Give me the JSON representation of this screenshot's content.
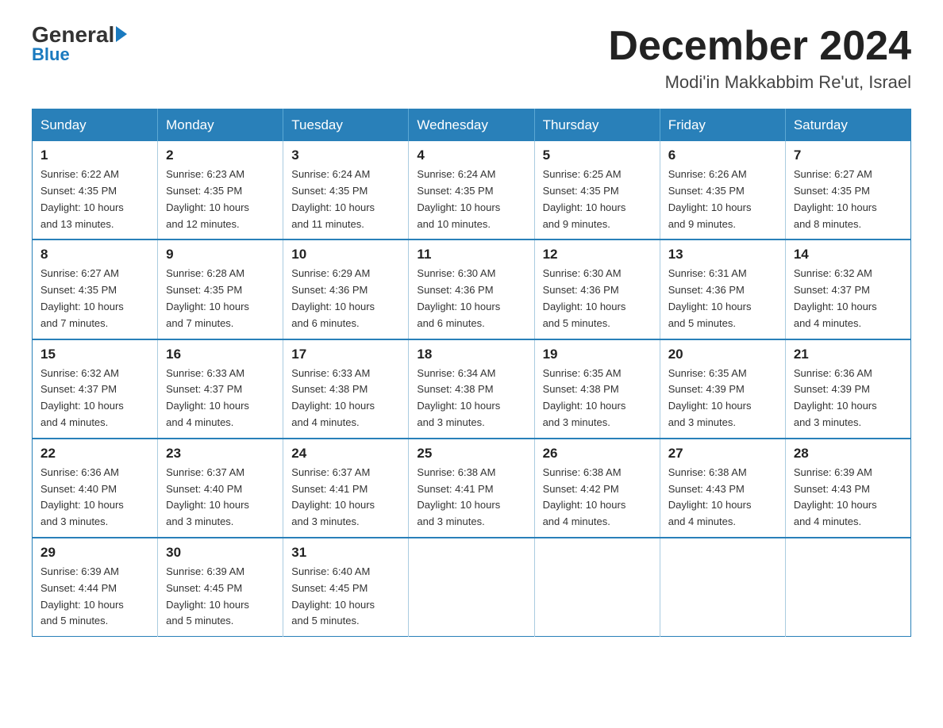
{
  "logo": {
    "general": "General",
    "blue": "Blue"
  },
  "header": {
    "month_year": "December 2024",
    "location": "Modi'in Makkabbim Re'ut, Israel"
  },
  "days_of_week": [
    "Sunday",
    "Monday",
    "Tuesday",
    "Wednesday",
    "Thursday",
    "Friday",
    "Saturday"
  ],
  "weeks": [
    [
      {
        "day": "1",
        "sunrise": "6:22 AM",
        "sunset": "4:35 PM",
        "daylight": "10 hours and 13 minutes."
      },
      {
        "day": "2",
        "sunrise": "6:23 AM",
        "sunset": "4:35 PM",
        "daylight": "10 hours and 12 minutes."
      },
      {
        "day": "3",
        "sunrise": "6:24 AM",
        "sunset": "4:35 PM",
        "daylight": "10 hours and 11 minutes."
      },
      {
        "day": "4",
        "sunrise": "6:24 AM",
        "sunset": "4:35 PM",
        "daylight": "10 hours and 10 minutes."
      },
      {
        "day": "5",
        "sunrise": "6:25 AM",
        "sunset": "4:35 PM",
        "daylight": "10 hours and 9 minutes."
      },
      {
        "day": "6",
        "sunrise": "6:26 AM",
        "sunset": "4:35 PM",
        "daylight": "10 hours and 9 minutes."
      },
      {
        "day": "7",
        "sunrise": "6:27 AM",
        "sunset": "4:35 PM",
        "daylight": "10 hours and 8 minutes."
      }
    ],
    [
      {
        "day": "8",
        "sunrise": "6:27 AM",
        "sunset": "4:35 PM",
        "daylight": "10 hours and 7 minutes."
      },
      {
        "day": "9",
        "sunrise": "6:28 AM",
        "sunset": "4:35 PM",
        "daylight": "10 hours and 7 minutes."
      },
      {
        "day": "10",
        "sunrise": "6:29 AM",
        "sunset": "4:36 PM",
        "daylight": "10 hours and 6 minutes."
      },
      {
        "day": "11",
        "sunrise": "6:30 AM",
        "sunset": "4:36 PM",
        "daylight": "10 hours and 6 minutes."
      },
      {
        "day": "12",
        "sunrise": "6:30 AM",
        "sunset": "4:36 PM",
        "daylight": "10 hours and 5 minutes."
      },
      {
        "day": "13",
        "sunrise": "6:31 AM",
        "sunset": "4:36 PM",
        "daylight": "10 hours and 5 minutes."
      },
      {
        "day": "14",
        "sunrise": "6:32 AM",
        "sunset": "4:37 PM",
        "daylight": "10 hours and 4 minutes."
      }
    ],
    [
      {
        "day": "15",
        "sunrise": "6:32 AM",
        "sunset": "4:37 PM",
        "daylight": "10 hours and 4 minutes."
      },
      {
        "day": "16",
        "sunrise": "6:33 AM",
        "sunset": "4:37 PM",
        "daylight": "10 hours and 4 minutes."
      },
      {
        "day": "17",
        "sunrise": "6:33 AM",
        "sunset": "4:38 PM",
        "daylight": "10 hours and 4 minutes."
      },
      {
        "day": "18",
        "sunrise": "6:34 AM",
        "sunset": "4:38 PM",
        "daylight": "10 hours and 3 minutes."
      },
      {
        "day": "19",
        "sunrise": "6:35 AM",
        "sunset": "4:38 PM",
        "daylight": "10 hours and 3 minutes."
      },
      {
        "day": "20",
        "sunrise": "6:35 AM",
        "sunset": "4:39 PM",
        "daylight": "10 hours and 3 minutes."
      },
      {
        "day": "21",
        "sunrise": "6:36 AM",
        "sunset": "4:39 PM",
        "daylight": "10 hours and 3 minutes."
      }
    ],
    [
      {
        "day": "22",
        "sunrise": "6:36 AM",
        "sunset": "4:40 PM",
        "daylight": "10 hours and 3 minutes."
      },
      {
        "day": "23",
        "sunrise": "6:37 AM",
        "sunset": "4:40 PM",
        "daylight": "10 hours and 3 minutes."
      },
      {
        "day": "24",
        "sunrise": "6:37 AM",
        "sunset": "4:41 PM",
        "daylight": "10 hours and 3 minutes."
      },
      {
        "day": "25",
        "sunrise": "6:38 AM",
        "sunset": "4:41 PM",
        "daylight": "10 hours and 3 minutes."
      },
      {
        "day": "26",
        "sunrise": "6:38 AM",
        "sunset": "4:42 PM",
        "daylight": "10 hours and 4 minutes."
      },
      {
        "day": "27",
        "sunrise": "6:38 AM",
        "sunset": "4:43 PM",
        "daylight": "10 hours and 4 minutes."
      },
      {
        "day": "28",
        "sunrise": "6:39 AM",
        "sunset": "4:43 PM",
        "daylight": "10 hours and 4 minutes."
      }
    ],
    [
      {
        "day": "29",
        "sunrise": "6:39 AM",
        "sunset": "4:44 PM",
        "daylight": "10 hours and 5 minutes."
      },
      {
        "day": "30",
        "sunrise": "6:39 AM",
        "sunset": "4:45 PM",
        "daylight": "10 hours and 5 minutes."
      },
      {
        "day": "31",
        "sunrise": "6:40 AM",
        "sunset": "4:45 PM",
        "daylight": "10 hours and 5 minutes."
      },
      null,
      null,
      null,
      null
    ]
  ],
  "labels": {
    "sunrise": "Sunrise:",
    "sunset": "Sunset:",
    "daylight": "Daylight:"
  }
}
